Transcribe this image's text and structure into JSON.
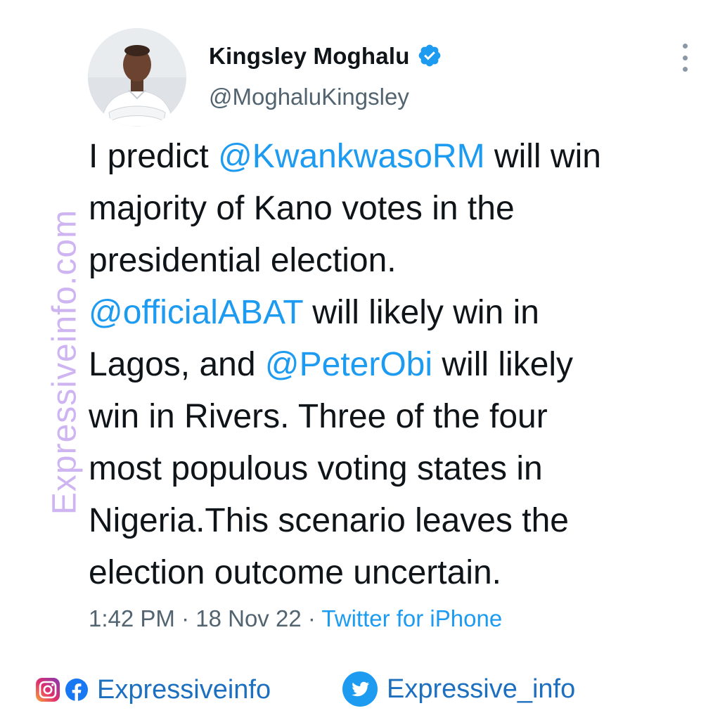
{
  "tweet": {
    "author": {
      "display_name": "Kingsley Moghalu",
      "handle": "@MoghaluKingsley",
      "verified": true,
      "avatar": "profile-photo"
    },
    "text_lines": [
      [
        {
          "t": "I predict "
        },
        {
          "t": "@KwankwasoRM",
          "mention": true
        },
        {
          "t": " will win"
        }
      ],
      [
        {
          "t": "majority of Kano votes in the"
        }
      ],
      [
        {
          "t": "presidential election."
        }
      ],
      [
        {
          "t": "@officialABAT",
          "mention": true
        },
        {
          "t": " will likely win in"
        }
      ],
      [
        {
          "t": "Lagos, and "
        },
        {
          "t": "@PeterObi",
          "mention": true
        },
        {
          "t": " will likely"
        }
      ],
      [
        {
          "t": "win in Rivers. Three of the four"
        }
      ],
      [
        {
          "t": "most populous voting states in"
        }
      ],
      [
        {
          "t": "Nigeria.This scenario leaves the"
        }
      ],
      [
        {
          "t": "election outcome uncertain."
        }
      ]
    ],
    "meta": {
      "time": "1:42 PM",
      "separator": " · ",
      "date": "18 Nov 22",
      "source": "Twitter for iPhone"
    },
    "more_icon": "more-options-vertical"
  },
  "watermark": "Expressiveinfo.com",
  "footer": {
    "left_label": "Expressiveinfo",
    "right_label": "Expressive_info",
    "icons": [
      "instagram-icon",
      "facebook-icon",
      "twitter-icon"
    ]
  },
  "colors": {
    "text": "#0f1419",
    "secondary": "#536471",
    "link": "#1d9bf0",
    "watermark": "#c6a9f0",
    "footer_text": "#1d6fbf"
  }
}
